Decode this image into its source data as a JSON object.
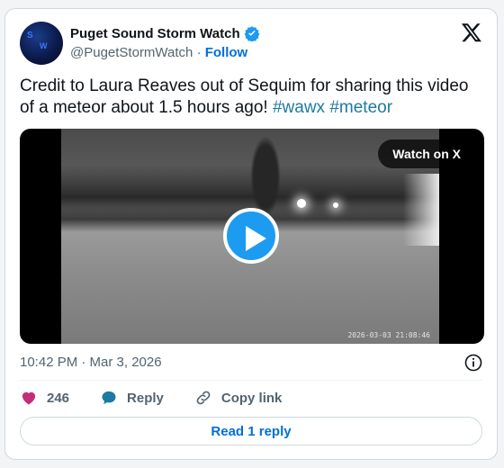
{
  "author": {
    "display_name": "Puget Sound Storm Watch",
    "handle": "@PugetStormWatch",
    "follow_label": "Follow"
  },
  "tweet": {
    "text_main": "Credit to Laura Reaves out of Sequim for sharing this video of a meteor about 1.5 hours ago! ",
    "hashtags": [
      "#wawx",
      "#meteor"
    ],
    "timestamp": "10:42 PM · Mar 3, 2026"
  },
  "media": {
    "watch_label": "Watch on X",
    "video_timestamp": "2026-03-03 21:08:46"
  },
  "actions": {
    "likes_count": "246",
    "reply_label": "Reply",
    "copy_link_label": "Copy link"
  },
  "footer": {
    "read_replies_label": "Read 1 reply"
  },
  "colors": {
    "link": "#006fd6",
    "hashtag": "#1d7aa0",
    "like": "#c32e7a",
    "reply": "#1d7aa0",
    "play": "#1d9bf0"
  },
  "icons": {
    "verified": "verified-badge-icon",
    "x_logo": "x-logo-icon",
    "play": "play-icon",
    "info": "info-icon",
    "like": "heart-icon",
    "reply": "reply-bubble-icon",
    "copy_link": "link-icon"
  }
}
